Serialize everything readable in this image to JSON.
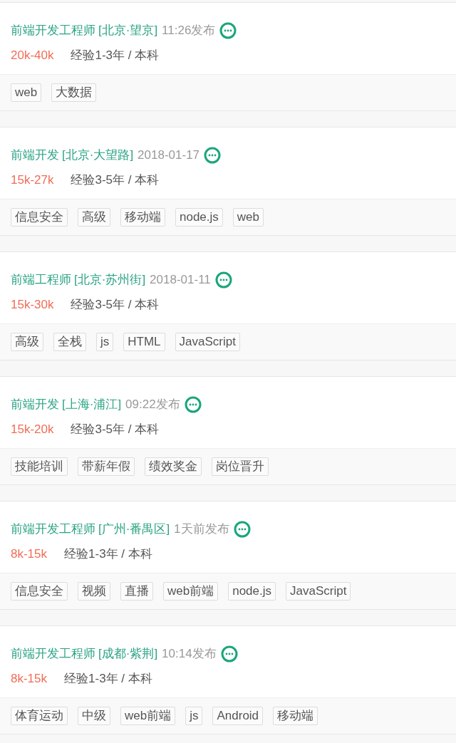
{
  "jobs": [
    {
      "title": "前端开发工程师",
      "location": "[北京·望京]",
      "time": "11:26发布",
      "salary": "20k-40k",
      "requirements": "经验1-3年 / 本科",
      "tags": [
        "web",
        "大数据"
      ]
    },
    {
      "title": "前端开发",
      "location": "[北京·大望路]",
      "time": "2018-01-17",
      "salary": "15k-27k",
      "requirements": "经验3-5年 / 本科",
      "tags": [
        "信息安全",
        "高级",
        "移动端",
        "node.js",
        "web"
      ]
    },
    {
      "title": "前端工程师",
      "location": "[北京·苏州街]",
      "time": "2018-01-11",
      "salary": "15k-30k",
      "requirements": "经验3-5年 / 本科",
      "tags": [
        "高级",
        "全栈",
        "js",
        "HTML",
        "JavaScript"
      ]
    },
    {
      "title": "前端开发",
      "location": "[上海·浦江]",
      "time": "09:22发布",
      "salary": "15k-20k",
      "requirements": "经验3-5年 / 本科",
      "tags": [
        "技能培训",
        "带薪年假",
        "绩效奖金",
        "岗位晋升"
      ]
    },
    {
      "title": "前端开发工程师",
      "location": "[广州·番禺区]",
      "time": "1天前发布",
      "salary": "8k-15k",
      "requirements": "经验1-3年 / 本科",
      "tags": [
        "信息安全",
        "视频",
        "直播",
        "web前端",
        "node.js",
        "JavaScript"
      ]
    },
    {
      "title": "前端开发工程师",
      "location": "[成都·紫荆]",
      "time": "10:14发布",
      "salary": "8k-15k",
      "requirements": "经验1-3年 / 本科",
      "tags": [
        "体育运动",
        "中级",
        "web前端",
        "js",
        "Android",
        "移动端"
      ]
    }
  ]
}
